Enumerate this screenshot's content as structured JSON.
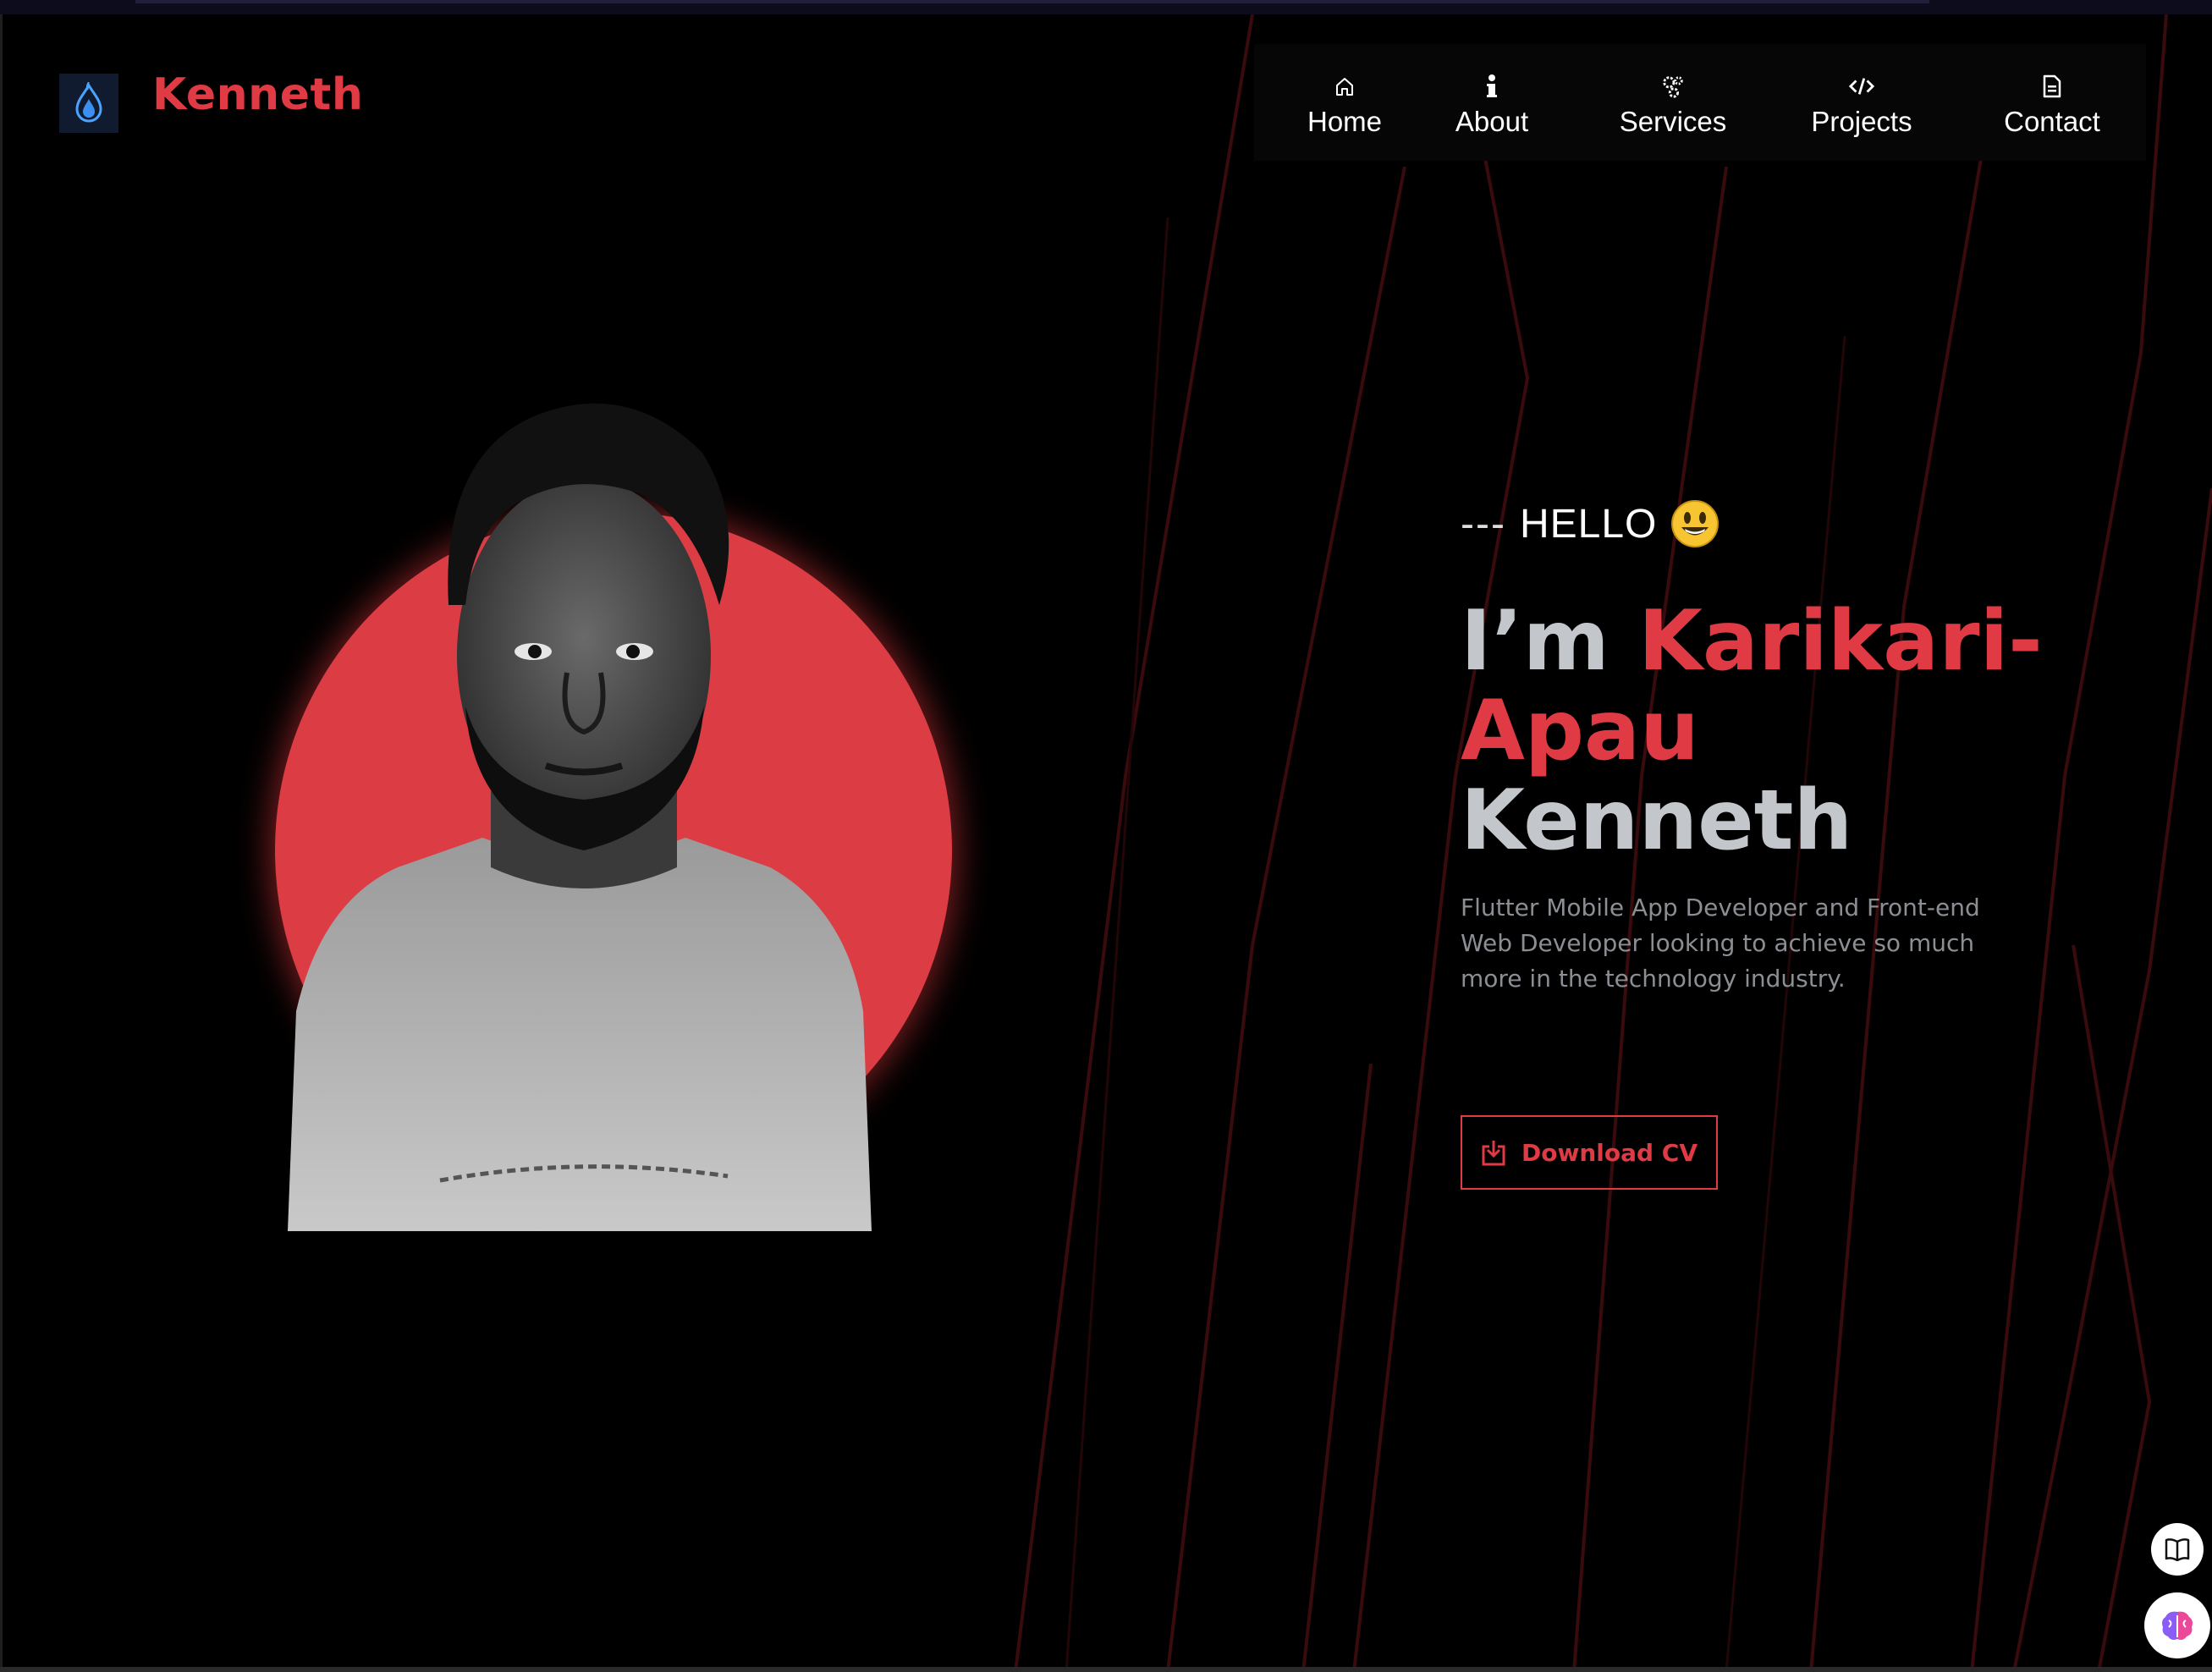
{
  "brand": {
    "name": "Kenneth",
    "logo_icon": "flame-drop-icon"
  },
  "nav": {
    "items": [
      {
        "label": "Home",
        "icon": "home-icon"
      },
      {
        "label": "About",
        "icon": "info-icon"
      },
      {
        "label": "Services",
        "icon": "gears-icon"
      },
      {
        "label": "Projects",
        "icon": "code-icon"
      },
      {
        "label": "Contact",
        "icon": "document-icon"
      }
    ]
  },
  "hero": {
    "greeting_dashes": "---",
    "greeting": "HELLO",
    "greeting_emoji": "smiley-icon",
    "prefix": "I’m",
    "name_highlight_1": "Karikari-",
    "name_highlight_2": "Apau",
    "name_rest": "Kenneth",
    "description": "Flutter Mobile App Developer and Front-end Web Developer looking to achieve so much more in the technology industry.",
    "cv_button": "Download CV"
  },
  "colors": {
    "accent": "#e03a44",
    "background": "#000000",
    "headline_gray": "#c3c7cc",
    "body_gray": "#8b8f94"
  }
}
